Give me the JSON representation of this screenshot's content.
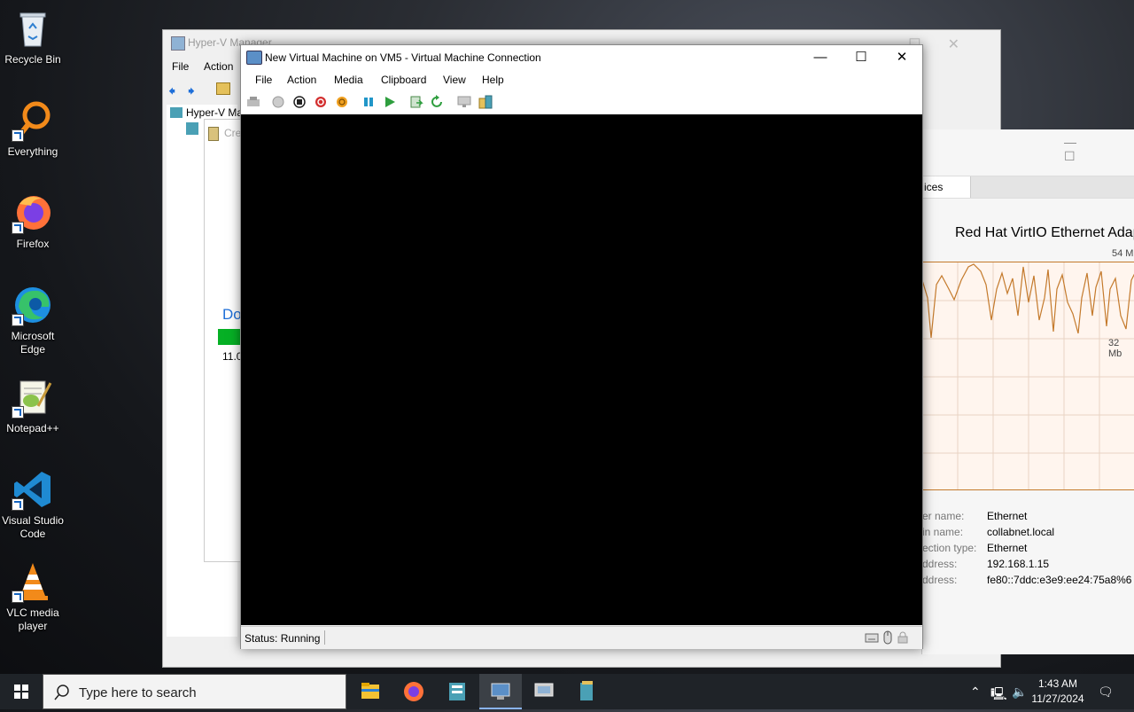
{
  "desktop": {
    "icons": [
      {
        "label": "Recycle Bin"
      },
      {
        "label": "Everything"
      },
      {
        "label": "Firefox"
      },
      {
        "label": "Microsoft Edge"
      },
      {
        "label": "Notepad++"
      },
      {
        "label": "Visual Studio Code"
      },
      {
        "label": "VLC media player"
      }
    ]
  },
  "hyperv_manager": {
    "title": "Hyper-V Manager",
    "menu": [
      "File",
      "Action"
    ],
    "tree_root": "Hyper-V Ma",
    "tree_child": "Cre",
    "progress_label": "Do",
    "progress_value": "11.0"
  },
  "network_window": {
    "tab_label": "ices",
    "adapter_name": "Red Hat VirtIO Ethernet Adapt",
    "scale_top": "54 M",
    "scale_mid": "32 Mb",
    "details": [
      {
        "key": "er name:",
        "value": "Ethernet"
      },
      {
        "key": "in name:",
        "value": "collabnet.local"
      },
      {
        "key": "ection type:",
        "value": "Ethernet"
      },
      {
        "key": "ddress:",
        "value": "192.168.1.15"
      },
      {
        "key": "ddress:",
        "value": "fe80::7ddc:e3e9:ee24:75a8%6"
      }
    ]
  },
  "vm_window": {
    "title": "New Virtual Machine on VM5 - Virtual Machine Connection",
    "menu": [
      "File",
      "Action",
      "Media",
      "Clipboard",
      "View",
      "Help"
    ],
    "status": "Status: Running"
  },
  "taskbar": {
    "search_placeholder": "Type here to search",
    "time": "1:43 AM",
    "date": "11/27/2024"
  },
  "colors": {
    "taskbar_bg": "#1f2328",
    "graph_line": "#c47a2c",
    "progress_green": "#06b025"
  }
}
